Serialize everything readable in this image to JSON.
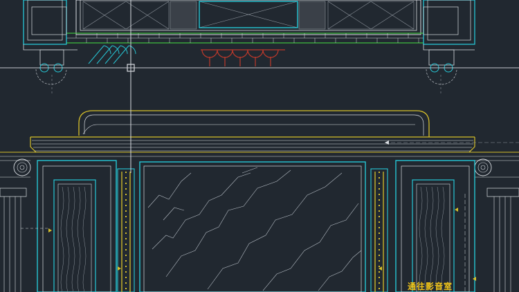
{
  "colors": {
    "background": "#212830",
    "cyan": "#27c7d6",
    "yellow": "#d8c12a",
    "white": "#d9dde2",
    "grey": "#8d949c",
    "green": "#3fbf3f",
    "red": "#c0392b",
    "annotation": "#f0c419"
  },
  "annotation": {
    "label": "通往影音室"
  },
  "cursor": {
    "type": "crosshair"
  }
}
